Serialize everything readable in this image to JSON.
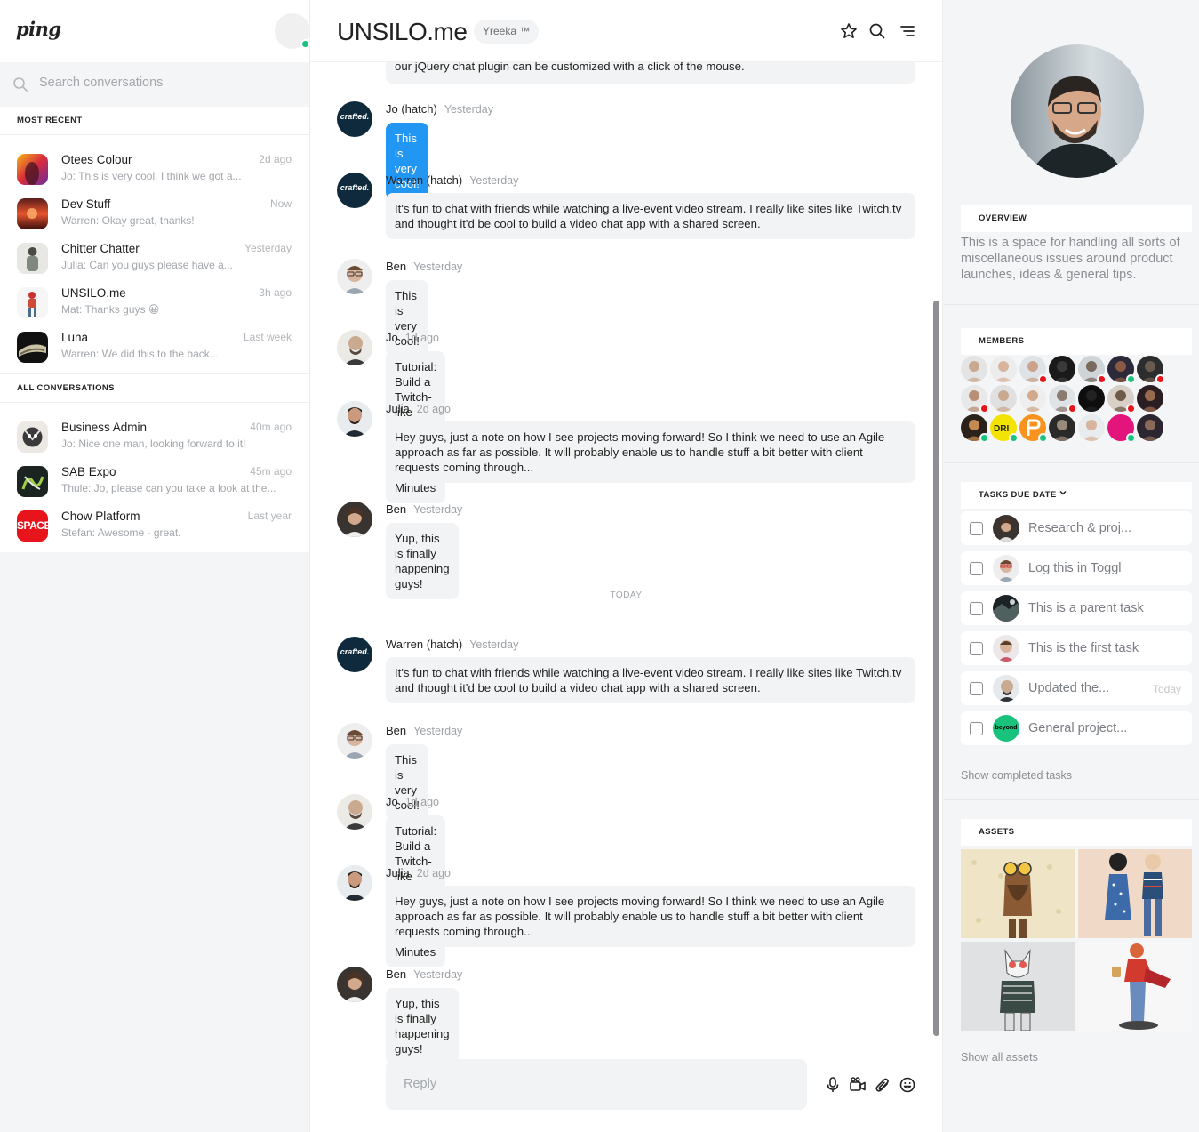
{
  "app": {
    "logo": "ping"
  },
  "sidebar": {
    "search_placeholder": "Search conversations",
    "most_recent_label": "MOST RECENT",
    "all_conversations_label": "ALL CONVERSATIONS",
    "recent": [
      {
        "name": "Otees Colour",
        "preview": "Jo: This is very cool. I think we got a...",
        "time": "2d ago"
      },
      {
        "name": "Dev Stuff",
        "preview": "Warren: Okay great, thanks!",
        "time": "Now"
      },
      {
        "name": "Chitter Chatter",
        "preview": "Julia: Can you guys please have a...",
        "time": "Yesterday"
      },
      {
        "name": "UNSILO.me",
        "preview": "Mat: Thanks guys 😀",
        "time": "3h ago"
      },
      {
        "name": "Luna",
        "preview": "Warren: We did this to the back...",
        "time": "Last week"
      }
    ],
    "all": [
      {
        "name": "Business Admin",
        "preview": "Jo: Nice one man, looking forward to it!",
        "time": "40m ago"
      },
      {
        "name": "SAB Expo",
        "preview": "Thule: Jo, please can you take a look at the...",
        "time": "45m ago"
      },
      {
        "name": "Chow Platform",
        "preview": "Stefan: Awesome - great.",
        "time": "Last year",
        "avatar_text": "SPACE"
      }
    ]
  },
  "chat": {
    "title": "UNSILO.me",
    "tag": "Yreeka ™",
    "top_partial": "our jQuery chat plugin can be customized with a click of the mouse.",
    "today_label": "TODAY",
    "reply_placeholder": "Reply",
    "crafted_text": "crafted.",
    "messages": [
      {
        "author": "Jo (hatch)",
        "time": "Yesterday",
        "text": "This is very cool!"
      },
      {
        "author": "Warren (hatch)",
        "time": "Yesterday",
        "text": "It's fun to chat with friends while watching a live-event video stream. I really like sites like Twitch.tv and thought it'd be cool to build a video chat app with a shared screen."
      },
      {
        "author": "Ben",
        "time": "Yesterday",
        "text": "This is very cool!"
      },
      {
        "author": "Jo",
        "time": "1d ago",
        "text": "Tutorial: Build a Twitch-like Video Chat App in 10 Minutes"
      },
      {
        "author": "Julia",
        "time": "2d ago",
        "text": "Hey guys, just a note on how I see projects moving forward! So I think we need to use an Agile approach as far as possible. It will probably enable us to handle stuff a bit better with client requests coming through..."
      },
      {
        "author": "Ben",
        "time": "Yesterday",
        "text": "Yup, this is finally happening guys!"
      },
      {
        "author": "Warren (hatch)",
        "time": "Yesterday",
        "text": "It's fun to chat with friends while watching a live-event video stream. I really like sites like Twitch.tv and thought it'd be cool to build a video chat app with a shared screen."
      },
      {
        "author": "Ben",
        "time": "Yesterday",
        "text": "This is very cool!"
      },
      {
        "author": "Jo",
        "time": "1d ago",
        "text": "Tutorial: Build a Twitch-like Video Chat App in 10 Minutes"
      },
      {
        "author": "Julia",
        "time": "2d ago",
        "text": "Hey guys, just a note on how I see projects moving forward! So I think we need to use an Agile approach as far as possible. It will probably enable us to handle stuff a bit better with client requests coming through..."
      },
      {
        "author": "Ben",
        "time": "Yesterday",
        "text": "Yup, this is finally happening guys!"
      }
    ]
  },
  "right": {
    "overview_label": "OVERVIEW",
    "overview_text": "This is a space for handling all sorts of miscellaneous issues around product launches, ideas & general tips.",
    "members_label": "MEMBERS",
    "member_badge_text": "DRI",
    "tasks_label": "TASKS DUE DATE",
    "tasks": [
      {
        "label": "Research & proj...",
        "due": ""
      },
      {
        "label": "Log this in Toggl",
        "due": ""
      },
      {
        "label": "This is a parent task",
        "due": ""
      },
      {
        "label": "This is the first task",
        "due": ""
      },
      {
        "label": "Updated the...",
        "due": "Today"
      },
      {
        "label": "General project...",
        "due": "",
        "avatar_text": "beyond"
      }
    ],
    "show_completed": "Show completed tasks",
    "assets_label": "ASSETS",
    "show_assets": "Show all assets"
  },
  "colors": {
    "accent_blue": "#2196f3",
    "online_green": "#19c37d",
    "busy_red": "#e8141c"
  }
}
